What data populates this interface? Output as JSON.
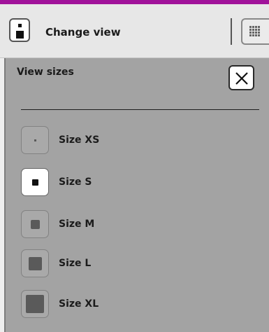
{
  "header": {
    "title": "Change view",
    "accent_color": "#a0129a",
    "view_icon": "view-toggle-icon",
    "grid_icon": "grid-icon"
  },
  "panel": {
    "title": "View sizes",
    "close_icon": "close-icon",
    "sizes": [
      {
        "label": "Size XS",
        "selected": false
      },
      {
        "label": "Size S",
        "selected": true
      },
      {
        "label": "Size M",
        "selected": false
      },
      {
        "label": "Size L",
        "selected": false
      },
      {
        "label": "Size XL",
        "selected": false
      }
    ]
  }
}
